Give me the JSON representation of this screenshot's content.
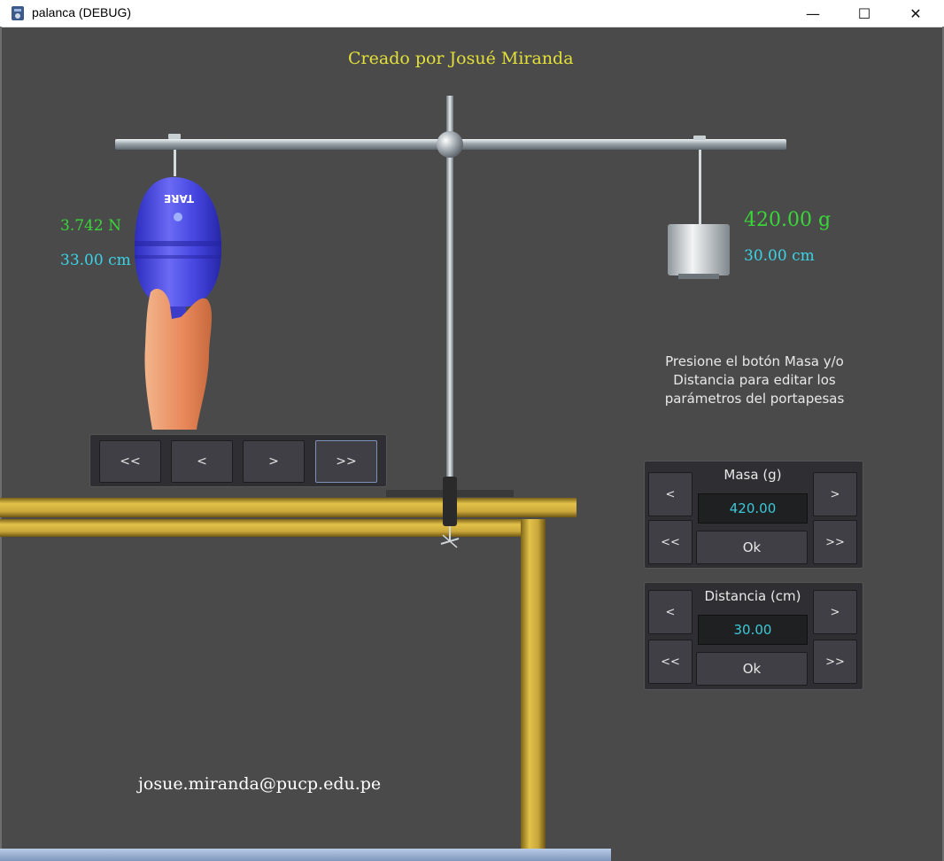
{
  "window": {
    "title": "palanca (DEBUG)",
    "minimize_label": "—",
    "maximize_label": "☐",
    "close_label": "✕"
  },
  "header": {
    "credit": "Creado por Josué Miranda"
  },
  "dynamometer": {
    "label": "TARE",
    "force": "3.742 N",
    "distance": "33.00 cm"
  },
  "weight": {
    "mass": "420.00 g",
    "distance": "30.00 cm"
  },
  "instructions": {
    "lines": [
      "Presione el botón Masa y/o",
      "Distancia para editar los",
      "parámetros del portapesas"
    ]
  },
  "dyn_controls": {
    "fast_left": "<<",
    "left": "<",
    "right": ">",
    "fast_right": ">>"
  },
  "mass_panel": {
    "label": "Masa (g)",
    "value": "420.00",
    "ok": "Ok",
    "dec": "<",
    "inc": ">",
    "fast_dec": "<<",
    "fast_inc": ">>"
  },
  "distance_panel": {
    "label": "Distancia (cm)",
    "value": "30.00",
    "ok": "Ok",
    "dec": "<",
    "inc": ">",
    "fast_dec": "<<",
    "fast_inc": ">>"
  },
  "footer": {
    "email": "josue.miranda@pucp.edu.pe"
  },
  "colors": {
    "background": "#4a4a4a",
    "credit": "#e4e03a",
    "force": "#39d639",
    "distance": "#3cd3e6",
    "table_wood": "#c9a73a",
    "dynamometer": "#4a4ae0"
  }
}
